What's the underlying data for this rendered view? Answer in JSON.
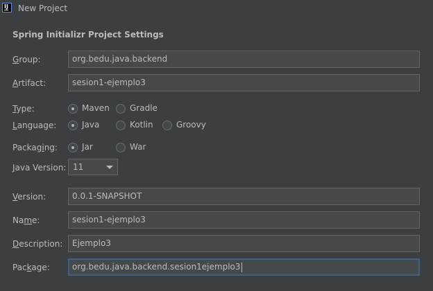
{
  "window": {
    "title": "New Project",
    "icon": "intellij-idea-icon"
  },
  "section": {
    "title": "Spring Initializr Project Settings"
  },
  "fields": {
    "group": {
      "label_mnemonic": "G",
      "label_rest": "roup:",
      "value": "org.bedu.java.backend"
    },
    "artifact": {
      "label_mnemonic": "A",
      "label_rest": "rtifact:",
      "value": "sesion1-ejemplo3"
    },
    "version": {
      "label_mnemonic": "V",
      "label_rest": "ersion:",
      "value": "0.0.1-SNAPSHOT"
    },
    "name": {
      "label_pre": "Na",
      "label_mnemonic": "m",
      "label_rest": "e:",
      "value": "sesion1-ejemplo3"
    },
    "description": {
      "label_mnemonic": "D",
      "label_rest": "escription:",
      "value": "Ejemplo3"
    },
    "package": {
      "label_pre": "Pac",
      "label_mnemonic": "k",
      "label_rest": "age:",
      "value": "org.bedu.java.backend.sesion1ejemplo3"
    }
  },
  "type": {
    "label_mnemonic": "T",
    "label_rest": "ype:",
    "options": [
      "Maven",
      "Gradle"
    ],
    "selected": "Maven"
  },
  "language": {
    "label_mnemonic": "L",
    "label_rest": "anguage:",
    "options": [
      "Java",
      "Kotlin",
      "Groovy"
    ],
    "selected": "Java"
  },
  "packaging": {
    "label_pre": "Packag",
    "label_mnemonic": "i",
    "label_rest": "ng:",
    "options": [
      "Jar",
      "War"
    ],
    "selected": "Jar"
  },
  "java_version": {
    "label_mnemonic": "J",
    "label_rest": "ava Version:",
    "selected": "11"
  },
  "colors": {
    "background": "#3c3f41",
    "field_background": "#45494a",
    "field_border": "#646464",
    "focus_border": "#3d6185",
    "text": "#bbbbbb"
  }
}
